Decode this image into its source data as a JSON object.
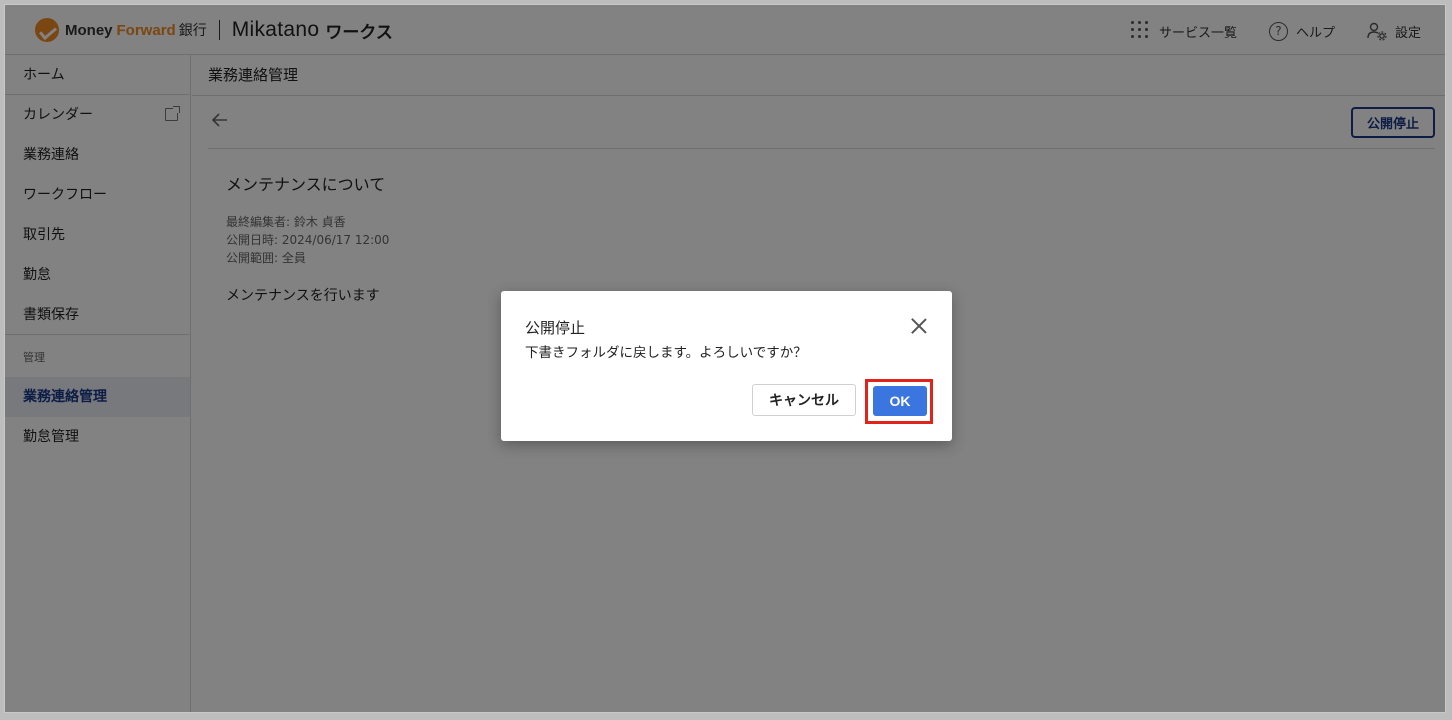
{
  "header": {
    "brand_money": "Money",
    "brand_forward": "Forward",
    "brand_bank": "銀行",
    "brand_mikatano": "Mikatano",
    "brand_works": "ワークス",
    "nav": [
      {
        "label": "サービス一覧",
        "icon": "apps-grid-icon"
      },
      {
        "label": "ヘルプ",
        "icon": "help-icon"
      },
      {
        "label": "設定",
        "icon": "user-settings-icon"
      }
    ]
  },
  "sidebar": {
    "home": "ホーム",
    "items": [
      {
        "label": "カレンダー",
        "icon": "external-link-icon"
      },
      {
        "label": "業務連絡"
      },
      {
        "label": "ワークフロー"
      },
      {
        "label": "取引先"
      },
      {
        "label": "勤怠"
      },
      {
        "label": "書類保存"
      }
    ],
    "section_label": "管理",
    "admin_items": [
      {
        "label": "業務連絡管理",
        "active": true
      },
      {
        "label": "勤怠管理"
      }
    ]
  },
  "main": {
    "page_title": "業務連絡管理",
    "unpublish_label": "公開停止",
    "post": {
      "title": "メンテナンスについて",
      "last_editor": "最終編集者: 鈴木 貞香",
      "published_at": "公開日時: 2024/06/17 12:00",
      "scope": "公開範囲: 全員",
      "body": "メンテナンスを行います"
    }
  },
  "dialog": {
    "title": "公開停止",
    "message": "下書きフォルダに戻します。よろしいですか？",
    "cancel_label": "キャンセル",
    "ok_label": "OK"
  },
  "colors": {
    "brand_orange": "#f08a24",
    "primary_blue": "#3b76e0",
    "navy": "#1c3a8a",
    "highlight_red": "#e0241b"
  }
}
